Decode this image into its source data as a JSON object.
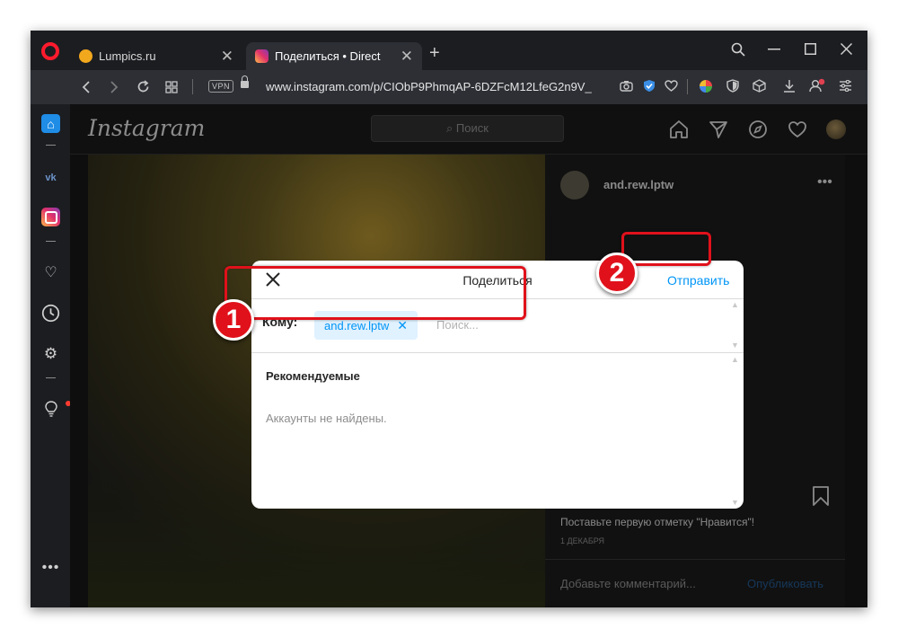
{
  "browser": {
    "tabs": [
      {
        "title": "Lumpics.ru",
        "close": "✕"
      },
      {
        "title": "Поделиться • Direct",
        "close": "✕"
      }
    ],
    "new_tab": "+",
    "vpn_badge": "VPN",
    "url": "www.instagram.com/p/CIObP9PhmqAP-6DZFcM12LfeG2n9V_"
  },
  "instagram": {
    "logo_text": "Instagram",
    "search_placeholder": "⌕ Поиск",
    "post": {
      "username": "and.rew.lptw",
      "more": "•••",
      "likes_text": "Поставьте первую отметку \"Нравится\"!",
      "date": "1 ДЕКАБРЯ",
      "comment_placeholder": "Добавьте комментарий...",
      "publish_label": "Опубликовать"
    }
  },
  "share_dialog": {
    "title": "Поделиться",
    "send_label": "Отправить",
    "to_label": "Кому:",
    "recipient": "and.rew.lptw",
    "search_placeholder": "Поиск...",
    "suggested_heading": "Рекомендуемые",
    "empty_text": "Аккаунты не найдены."
  },
  "annotations": {
    "step1": "1",
    "step2": "2",
    "color": "#e0111b"
  },
  "colors": {
    "accent_blue": "#0095f6",
    "opera_red": "#ff1b2d"
  }
}
